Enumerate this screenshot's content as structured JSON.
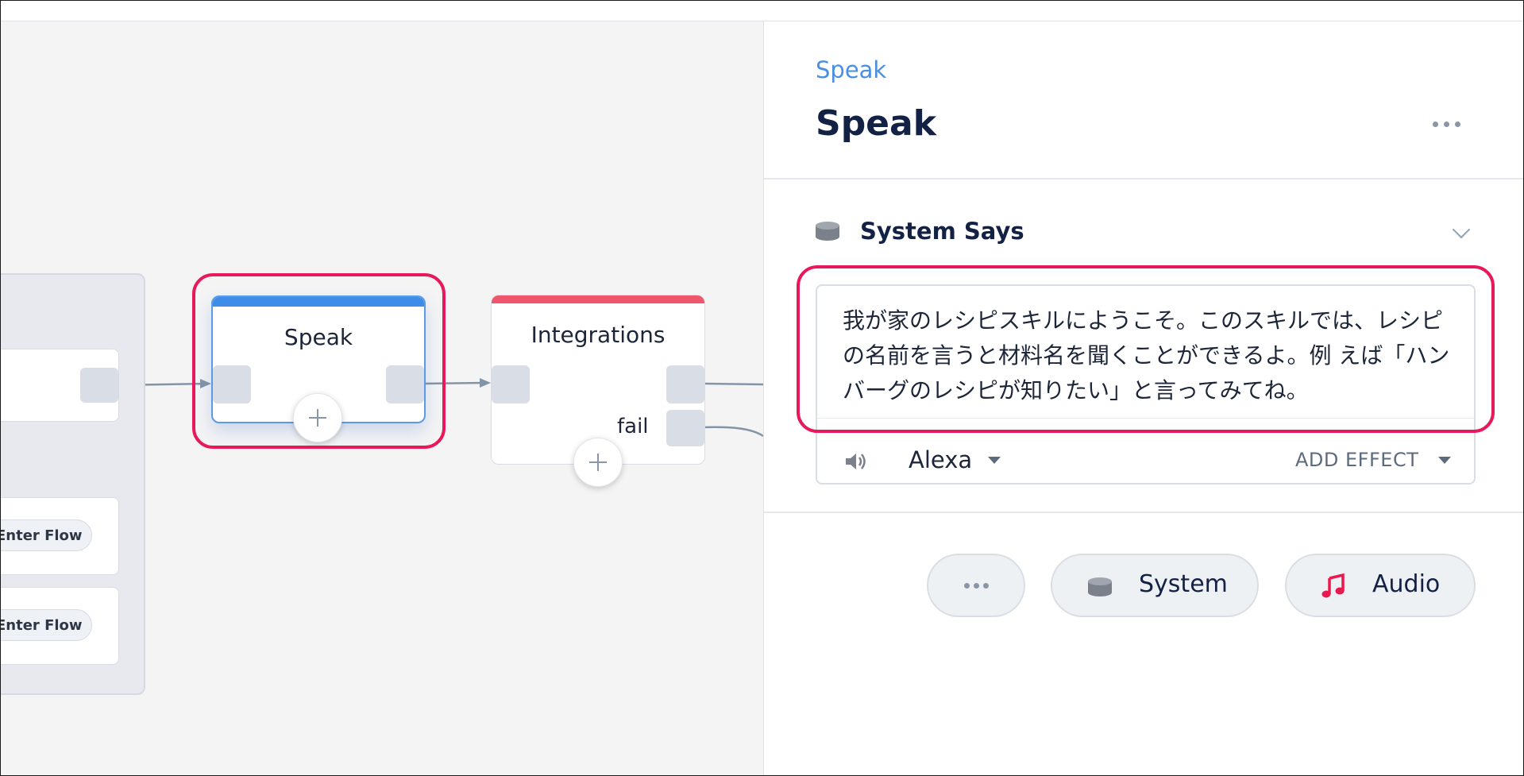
{
  "canvas": {
    "group": {
      "enter_flow_1": "Enter Flow",
      "enter_flow_2": "Enter Flow"
    },
    "speak_node": {
      "title": "Speak"
    },
    "integrations_node": {
      "title": "Integrations",
      "fail_label": "fail"
    }
  },
  "panel": {
    "breadcrumb": "Speak",
    "title": "Speak",
    "section": {
      "label": "System Says",
      "text": "我が家のレシピスキルにようこそ。このスキルでは、レシピの名前を言うと材料名を聞くことができるよ。例 えば「ハンバーグのレシピが知りたい」と言ってみてね。",
      "voice": "Alexa",
      "add_effect": "ADD EFFECT"
    },
    "buttons": {
      "more": "•••",
      "system": "System",
      "audio": "Audio"
    }
  },
  "colors": {
    "accent_blue": "#3d8de8",
    "integration_red": "#f0556e",
    "highlight": "#e8195a",
    "audio_icon": "#e8194f"
  },
  "icons": [
    "more-options-icon",
    "chevron-down-icon",
    "speaker-device-icon",
    "volume-icon",
    "caret-down-icon",
    "plus-icon",
    "music-note-icon"
  ]
}
